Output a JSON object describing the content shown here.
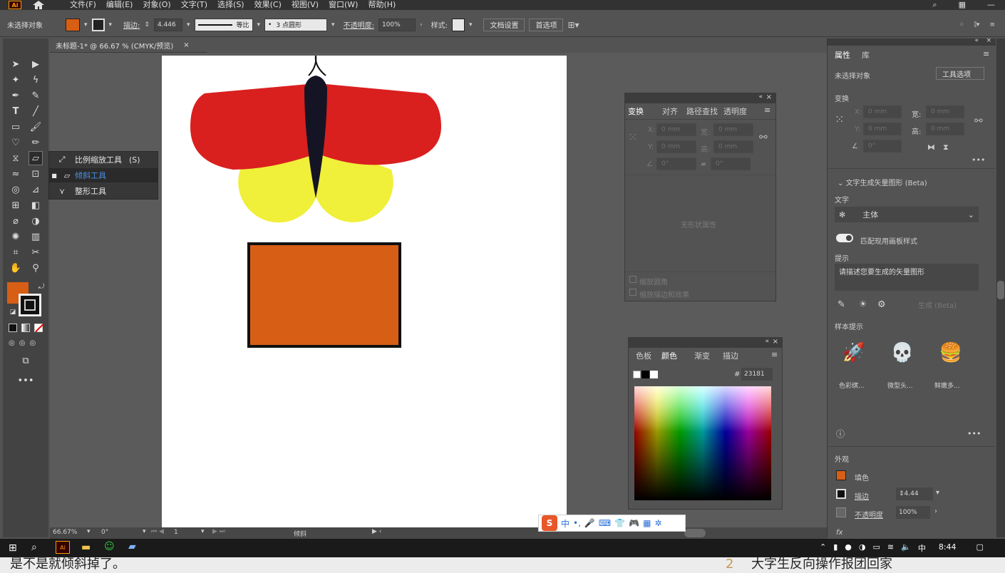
{
  "app": {
    "logo": "Ai",
    "home_icon": "home-icon"
  },
  "menu": [
    "文件(F)",
    "编辑(E)",
    "对象(O)",
    "文字(T)",
    "选择(S)",
    "效果(C)",
    "视图(V)",
    "窗口(W)",
    "帮助(H)"
  ],
  "control": {
    "selection": "未选择对象",
    "fill_color": "#d75e15",
    "stroke_label": "描边:",
    "stroke_weight": "4.446",
    "stroke_profile": "等比",
    "brush": "3 点圆形",
    "opacity_label": "不透明度:",
    "opacity": "100%",
    "style_label": "样式:",
    "doc_setup": "文档设置",
    "preferences": "首选项"
  },
  "document": {
    "tab_title": "未标题-1* @ 66.67 % (CMYK/预览)",
    "close": "×"
  },
  "flyout": {
    "items": [
      "比例缩放工具",
      "倾斜工具",
      "整形工具"
    ],
    "shortcut": "(S)"
  },
  "transform_panel": {
    "tabs": [
      "变换",
      "对齐",
      "路径查找",
      "透明度"
    ],
    "x_label": "X:",
    "y_label": "Y:",
    "w_label": "宽:",
    "h_label": "高:",
    "zero": "0 mm",
    "angle": "0°",
    "no_shape": "无形状属性",
    "scale_corners": "缩放圆角",
    "scale_strokes": "缩放描边和效果"
  },
  "color_panel": {
    "tabs": [
      "色板",
      "颜色",
      "渐变",
      "描边"
    ],
    "hash": "#",
    "hex": "23181"
  },
  "properties": {
    "tabs": [
      "属性",
      "库"
    ],
    "selection": "未选择对象",
    "tool_options": "工具选项",
    "transform": "变换",
    "x": "X:",
    "y": "Y:",
    "w": "宽:",
    "h": "高:",
    "zero": "0 mm",
    "angle": "0°",
    "text_to_vector": "文字生成矢量图形 (Beta)",
    "text_label": "文字",
    "subject": "主体",
    "match_style": "匹配现用画板样式",
    "prompt_label": "提示",
    "prompt_placeholder": "请描述您要生成的矢量图形",
    "generate": "生成 (Beta)",
    "samples_label": "样本提示",
    "samples": [
      "色彩缤...",
      "微型头...",
      "鲜嫩多..."
    ],
    "appearance": "外观",
    "fill": "填色",
    "stroke": "描边",
    "stroke_value": "4.44",
    "opacity": "不透明度",
    "opacity_value": "100%",
    "fx": "fx"
  },
  "status": {
    "zoom": "66.67%",
    "rotate": "0°",
    "page": "1",
    "tool": "倾斜"
  },
  "taskbar": {
    "ime": "中",
    "time": "8:44"
  },
  "subtitles": {
    "left": "是不是就倾斜掉了。",
    "number": "2",
    "right": "大字生反向操作报团回家"
  },
  "colors": {
    "accent_orange": "#d75e15",
    "wing_red": "#da1f1f",
    "wing_yellow": "#f0ef3a",
    "body": "#141424"
  }
}
